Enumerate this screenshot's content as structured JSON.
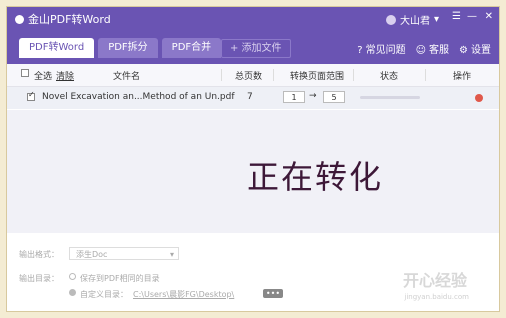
{
  "app": {
    "title": "金山PDF转Word",
    "user_name": "大山君"
  },
  "tabs": [
    {
      "label": "PDF转Word",
      "active": true
    },
    {
      "label": "PDF拆分",
      "active": false
    },
    {
      "label": "PDF合并",
      "active": false
    }
  ],
  "add_file_label": "+ 添加文件",
  "header_links": [
    {
      "icon": "question-icon",
      "label": "常见问题"
    },
    {
      "icon": "chat-icon",
      "label": "客服"
    },
    {
      "icon": "gear-icon",
      "label": "设置"
    }
  ],
  "columns": {
    "select_all": "全选",
    "clear": "清除",
    "file_name": "文件名",
    "page_count": "总页数",
    "range": "转换页面范围",
    "status": "状态",
    "action": "操作"
  },
  "files": [
    {
      "name": "Novel Excavation an...Method of an Un.pdf",
      "pages": "7",
      "range_from": "1",
      "range_to": "5",
      "arrow": "→"
    }
  ],
  "overlay_text": "正在转化",
  "output": {
    "format_label": "输出格式：",
    "format_value": "添生Doc",
    "dir_label": "输出目录：",
    "option_same": "保存到PDF相同的目录",
    "option_custom": "自定义目录：",
    "custom_path": "C:\\Users\\晨影FG\\Desktop\\",
    "browse": "•••"
  },
  "watermark": {
    "main": "开心经验",
    "sub": "jingyan.baidu.com"
  },
  "colors": {
    "header": "#6a54b3",
    "tab_inactive": "#8b78c9",
    "overlay_text": "#3d1838"
  }
}
